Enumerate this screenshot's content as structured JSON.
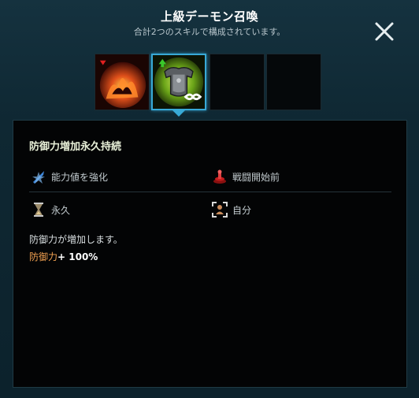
{
  "header": {
    "title": "上級デーモン召喚",
    "subtitle": "合計2つのスキルで構成されています。"
  },
  "close_icon": "close-icon",
  "skills": [
    {
      "icon": "demon-fire-icon",
      "selected": false
    },
    {
      "icon": "armor-buff-icon",
      "selected": true
    },
    {
      "icon": "",
      "selected": false
    },
    {
      "icon": "",
      "selected": false
    }
  ],
  "detail": {
    "name": "防御力増加永久持続",
    "type_label": "能力値を強化",
    "timing_label": "戦闘開始前",
    "duration_label": "永久",
    "target_label": "自分",
    "description": "防御力が増加します。",
    "effect_name": "防御力",
    "effect_value": "+ 100%"
  },
  "colors": {
    "accent": "#38a9d6",
    "effect_name": "#f0a050"
  }
}
